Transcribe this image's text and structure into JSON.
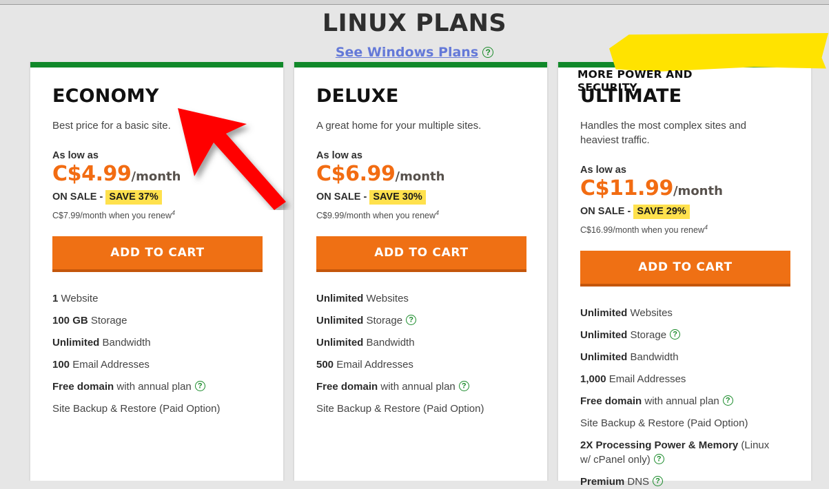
{
  "header": {
    "title": "LINUX PLANS",
    "link_label": "See Windows Plans",
    "link_help_icon": "help-circle-icon"
  },
  "annotation": {
    "arrow_icon": "red-arrow-up-left-icon",
    "arrow_color": "#ff0000"
  },
  "theme": {
    "page_background": "#e6e6e6",
    "card_background": "#ffffff",
    "accent_orange": "#f26c12",
    "button_orange": "#ef7014",
    "button_orange_shadow": "#c4560b",
    "top_bar_green": "#11892a",
    "help_icon_green": "#1a8b2a",
    "badge_yellow": "#ffe14d",
    "promo_yellow": "#ffe300",
    "link_blue": "#6479d8"
  },
  "cards": [
    {
      "name": "ECONOMY",
      "description": "Best price for a basic site.",
      "as_low_as": "As low as",
      "price": "C$4.99",
      "per": "/month",
      "sale_prefix": "ON SALE - ",
      "sale_badge": "SAVE 37%",
      "renew": "C$7.99/month when you renew",
      "renew_footnote": "4",
      "cta": "ADD TO CART",
      "promo": null,
      "features": [
        {
          "strong": "1",
          "rest": " Website",
          "help": false
        },
        {
          "strong": "100 GB",
          "rest": " Storage",
          "help": false
        },
        {
          "strong": "Unlimited",
          "rest": " Bandwidth",
          "help": false
        },
        {
          "strong": "100",
          "rest": " Email Addresses",
          "help": false
        },
        {
          "strong": "Free domain",
          "rest": " with annual plan",
          "help": true
        },
        {
          "strong": "",
          "rest": "Site Backup & Restore (Paid Option)",
          "help": false
        }
      ]
    },
    {
      "name": "DELUXE",
      "description": "A great home for your multiple sites.",
      "as_low_as": "As low as",
      "price": "C$6.99",
      "per": "/month",
      "sale_prefix": "ON SALE - ",
      "sale_badge": "SAVE 30%",
      "renew": "C$9.99/month when you renew",
      "renew_footnote": "4",
      "cta": "ADD TO CART",
      "promo": null,
      "features": [
        {
          "strong": "Unlimited",
          "rest": " Websites",
          "help": false
        },
        {
          "strong": "Unlimited",
          "rest": " Storage",
          "help": true
        },
        {
          "strong": "Unlimited",
          "rest": " Bandwidth",
          "help": false
        },
        {
          "strong": "500",
          "rest": " Email Addresses",
          "help": false
        },
        {
          "strong": "Free domain",
          "rest": " with annual plan",
          "help": true
        },
        {
          "strong": "",
          "rest": "Site Backup & Restore (Paid Option)",
          "help": false
        }
      ]
    },
    {
      "name": "ULTIMATE",
      "description": "Handles the most complex sites and heaviest traffic.",
      "as_low_as": "As low as",
      "price": "C$11.99",
      "per": "/month",
      "sale_prefix": "ON SALE - ",
      "sale_badge": "SAVE 29%",
      "renew": "C$16.99/month when you renew",
      "renew_footnote": "4",
      "cta": "ADD TO CART",
      "promo": "MORE POWER AND SECURITY",
      "features": [
        {
          "strong": "Unlimited",
          "rest": " Websites",
          "help": false
        },
        {
          "strong": "Unlimited",
          "rest": " Storage",
          "help": true
        },
        {
          "strong": "Unlimited",
          "rest": " Bandwidth",
          "help": false
        },
        {
          "strong": "1,000",
          "rest": " Email Addresses",
          "help": false
        },
        {
          "strong": "Free domain",
          "rest": " with annual plan",
          "help": true
        },
        {
          "strong": "",
          "rest": "Site Backup & Restore (Paid Option)",
          "help": false
        },
        {
          "strong": "2X  Processing Power & Memory",
          "rest": " (Linux w/ cPanel only)",
          "help": true
        },
        {
          "strong": "Premium",
          "rest": " DNS",
          "help": true
        }
      ]
    }
  ]
}
